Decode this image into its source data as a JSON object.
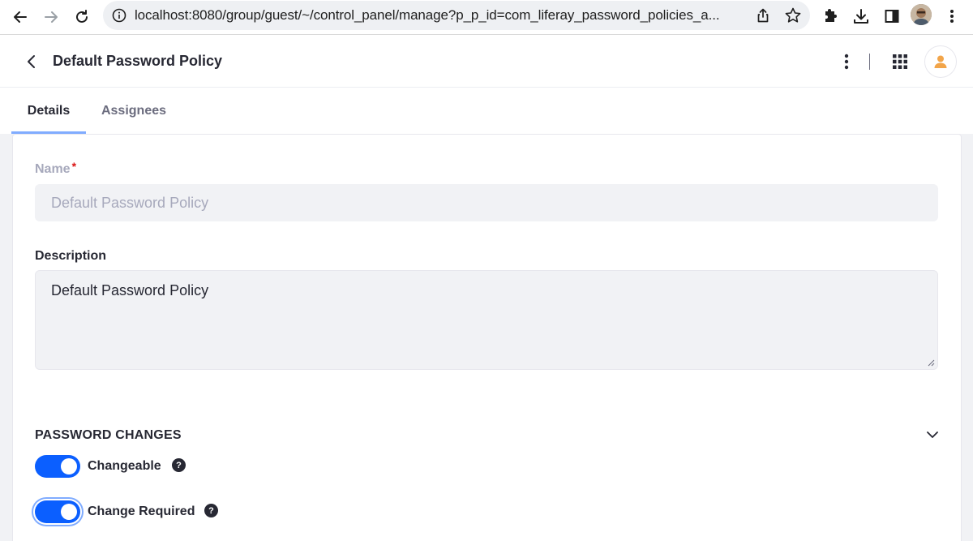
{
  "browser": {
    "url": "localhost:8080/group/guest/~/control_panel/manage?p_p_id=com_liferay_password_policies_a..."
  },
  "header": {
    "title": "Default Password Policy"
  },
  "tabs": [
    {
      "label": "Details",
      "active": true
    },
    {
      "label": "Assignees",
      "active": false
    }
  ],
  "form": {
    "name_label": "Name",
    "name_required_mark": "*",
    "name_value": "Default Password Policy",
    "description_label": "Description",
    "description_value": "Default Password Policy"
  },
  "password_changes": {
    "title": "PASSWORD CHANGES",
    "toggles": [
      {
        "label": "Changeable",
        "checked": true,
        "help": "?"
      },
      {
        "label": "Change Required",
        "checked": true,
        "help": "?"
      }
    ]
  },
  "colors": {
    "accent": "#0b5fff",
    "tab_indicator": "#80acff",
    "avatar_icon": "#f2a54a"
  }
}
